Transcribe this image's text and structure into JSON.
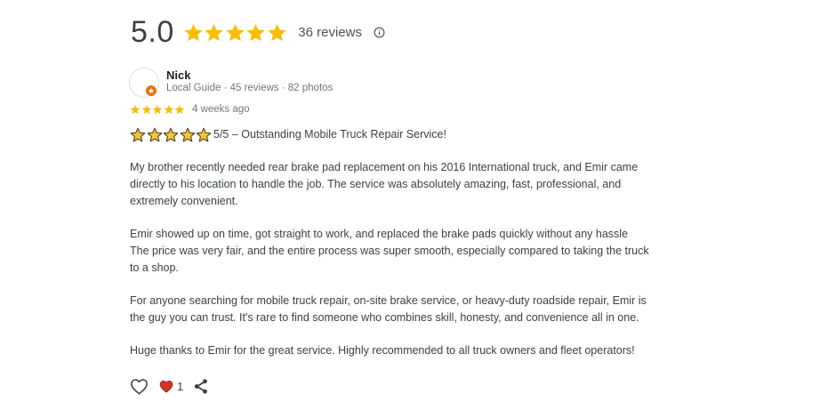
{
  "summary": {
    "rating": "5.0",
    "stars": 5,
    "review_count": "36 reviews",
    "star_color": "#fbbc04"
  },
  "review": {
    "reviewer_name": "Nick",
    "reviewer_meta": "Local Guide · 45 reviews · 82 photos",
    "star_rating": 5,
    "date": "4 weeks ago",
    "headline": "5/5 – Outstanding Mobile Truck Repair Service!",
    "paragraphs": [
      [
        "My brother recently needed rear brake pad replacement on his 2016 International truck, and Emir came",
        "directly to his location to handle the job. The service was absolutely amazing, fast, professional, and",
        "extremely convenient."
      ],
      [
        "Emir showed up on time, got straight to work, and replaced the brake pads quickly without any hassle",
        "The price was very fair, and the entire process was super smooth, especially compared to taking the truck",
        "to a shop."
      ],
      [
        "For anyone searching for mobile truck repair, on-site brake service, or heavy-duty roadside repair, Emir is",
        "the guy you can trust. It's rare to find someone who combines skill, honesty, and convenience all in one."
      ],
      [
        "Huge thanks to Emir for the great service. Highly recommended to all truck owners and fleet operators!"
      ]
    ],
    "like_count": "1",
    "heart_color": "#d93025"
  },
  "icons": {
    "info": "info-icon",
    "badge": "local-guide-badge-icon",
    "like": "heart-outline-icon",
    "reaction": "red-heart-icon",
    "share": "share-icon"
  }
}
